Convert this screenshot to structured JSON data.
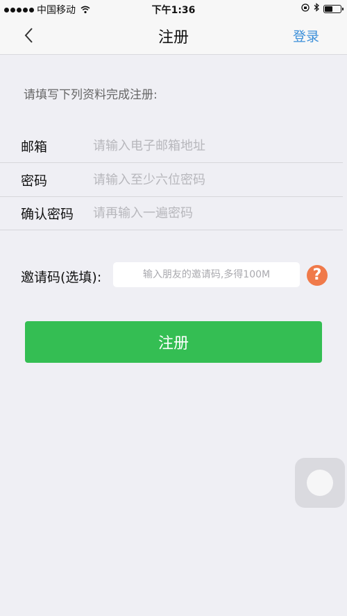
{
  "status_bar": {
    "carrier": "中国移动",
    "time": "下午1:36",
    "battery_level": 0.5
  },
  "nav": {
    "back_icon": "chevron-left-icon",
    "title": "注册",
    "login_label": "登录"
  },
  "form": {
    "instruction": "请填写下列资料完成注册:",
    "fields": [
      {
        "label": "邮箱",
        "placeholder": "请输入电子邮箱地址",
        "value": ""
      },
      {
        "label": "密码",
        "placeholder": "请输入至少六位密码",
        "value": ""
      },
      {
        "label": "确认密码",
        "placeholder": "请再输入一遍密码",
        "value": ""
      }
    ],
    "invite": {
      "label": "邀请码(选填):",
      "placeholder": "输入朋友的邀请码,多得100M",
      "help_symbol": "?"
    },
    "submit_label": "注册"
  },
  "colors": {
    "accent_blue": "#3b8fd9",
    "button_green": "#34be53",
    "help_orange": "#f07a4a"
  }
}
